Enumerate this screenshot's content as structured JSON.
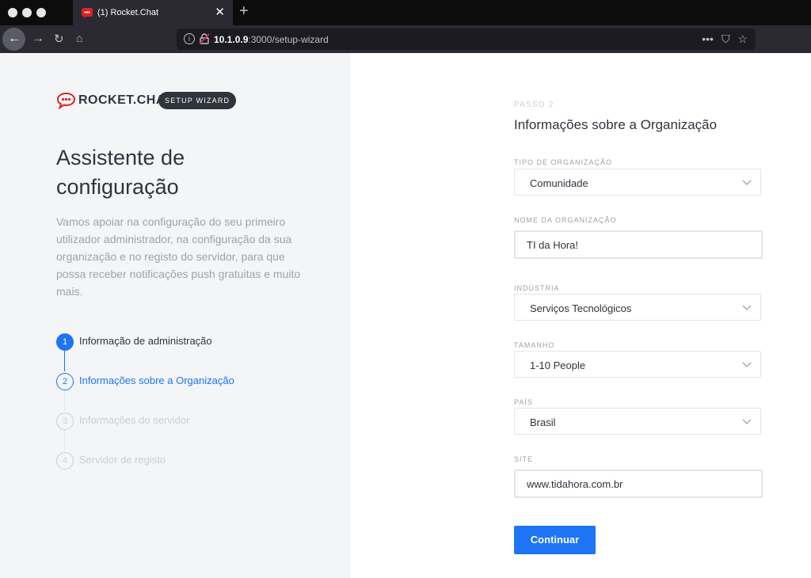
{
  "browser": {
    "tab_title": "(1) Rocket.Chat",
    "url_host": "10.1.0.9",
    "url_rest": ":3000/setup-wizard",
    "menu_dots": "•••"
  },
  "brand": {
    "name": "ROCKET.CHAT",
    "badge": "SETUP WIZARD"
  },
  "intro": {
    "title": "Assistente de configuração",
    "description": "Vamos apoiar na configuração do seu primeiro utilizador administrador, na configuração da sua organização e no registo do servidor, para que possa receber notificações push gratuitas e muito mais."
  },
  "steps": [
    {
      "num": "1",
      "label": "Informação de administração",
      "state": "done"
    },
    {
      "num": "2",
      "label": "Informações sobre a Organização",
      "state": "active"
    },
    {
      "num": "3",
      "label": "Informações do servidor",
      "state": "pending"
    },
    {
      "num": "4",
      "label": "Servidor de registo",
      "state": "pending"
    }
  ],
  "form": {
    "step_label": "PASSO 2",
    "title": "Informações sobre a Organização",
    "org_type": {
      "label": "TIPO DE ORGANIZAÇÃO",
      "value": "Comunidade"
    },
    "org_name": {
      "label": "NOME DA ORGANIZAÇÃO",
      "value": "TI da Hora!"
    },
    "industry": {
      "label": "INDÚSTRIA",
      "value": "Serviços Tecnológicos"
    },
    "size": {
      "label": "TAMANHO",
      "value": "1-10 People"
    },
    "country": {
      "label": "PAÍS",
      "value": "Brasil"
    },
    "site": {
      "label": "SITE",
      "value": "www.tidahora.com.br"
    },
    "submit": "Continuar"
  },
  "colors": {
    "accent": "#1d74f5",
    "brand_red": "#db2323",
    "text_dark": "#2f343d",
    "text_muted": "#9ea2a8"
  }
}
